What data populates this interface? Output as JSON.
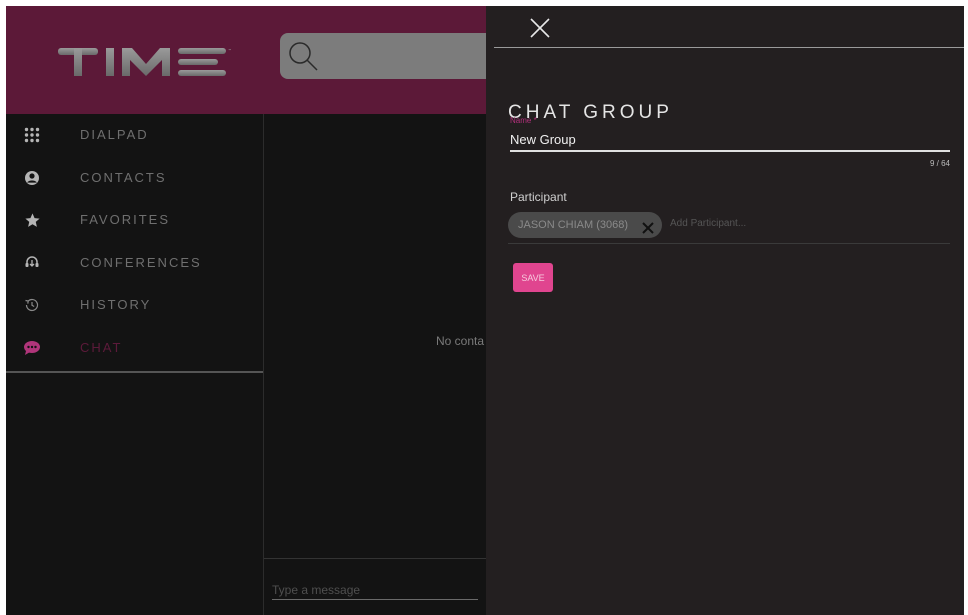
{
  "header": {
    "logo_text": "TIME",
    "search_icon": "search-icon",
    "colors": {
      "brand": "#5c1938",
      "accent": "#e0458f"
    }
  },
  "sidebar": {
    "items": [
      {
        "label": "DIALPAD",
        "icon": "dialpad-icon"
      },
      {
        "label": "CONTACTS",
        "icon": "contacts-icon"
      },
      {
        "label": "FAVORITES",
        "icon": "star-icon"
      },
      {
        "label": "CONFERENCES",
        "icon": "conference-icon"
      },
      {
        "label": "HISTORY",
        "icon": "history-icon"
      },
      {
        "label": "CHAT",
        "icon": "chat-icon",
        "active": true
      }
    ]
  },
  "main": {
    "empty_text": "No conta",
    "message_placeholder": "Type a message"
  },
  "panel": {
    "title": "CHAT GROUP",
    "name_label": "Name *",
    "name_value": "New Group",
    "name_counter": "9 / 64",
    "participant_label": "Participant",
    "participants": [
      "JASON CHIAM (3068)"
    ],
    "add_placeholder": "Add Participant...",
    "save_label": "SAVE"
  }
}
